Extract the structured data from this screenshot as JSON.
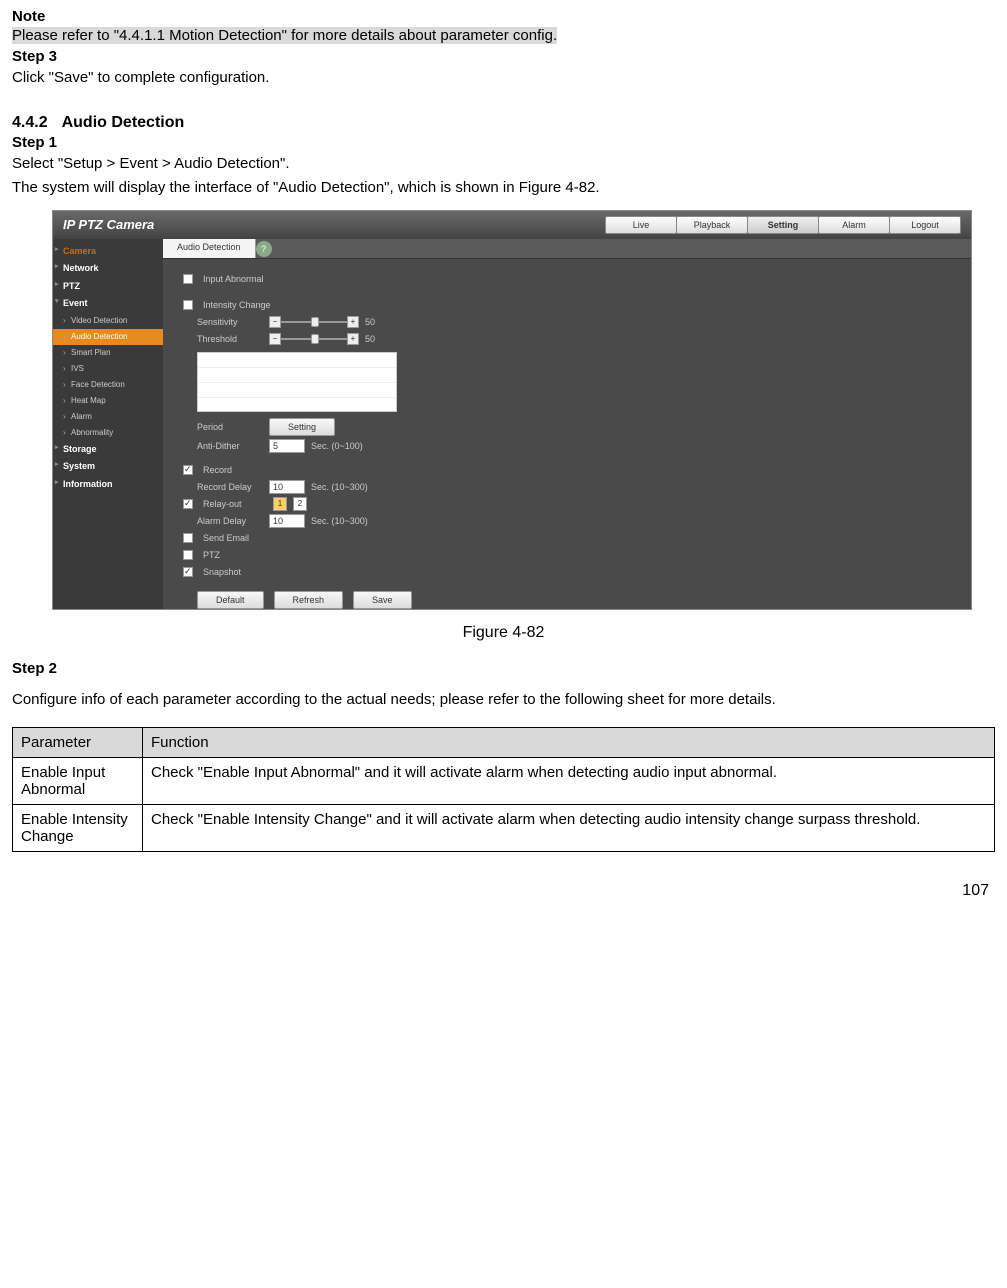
{
  "note": {
    "title": "Note",
    "body": "Please refer to \"4.4.1.1 Motion Detection\" for more details about parameter config."
  },
  "step3": {
    "title": "Step 3",
    "body": "Click \"Save\" to complete configuration."
  },
  "section": {
    "number": "4.4.2",
    "title": "Audio Detection"
  },
  "step1": {
    "title": "Step 1",
    "line1": "Select \"Setup > Event > Audio Detection\".",
    "line2": "The system will display the interface of \"Audio Detection\", which is shown in Figure 4-82."
  },
  "screenshot": {
    "logo": "IP PTZ Camera",
    "nav": {
      "live": "Live",
      "playback": "Playback",
      "setting": "Setting",
      "alarm": "Alarm",
      "logout": "Logout"
    },
    "sidebar": {
      "camera": "Camera",
      "network": "Network",
      "ptz": "PTZ",
      "event": "Event",
      "video_detection": "Video Detection",
      "audio_detection": "Audio Detection",
      "smart_plan": "Smart Plan",
      "ivs": "IVS",
      "face_detection": "Face Detection",
      "heat_map": "Heat Map",
      "alarm": "Alarm",
      "abnormality": "Abnormality",
      "storage": "Storage",
      "system": "System",
      "information": "Information"
    },
    "tab": "Audio Detection",
    "help": "?",
    "form": {
      "input_abnormal": "Input Abnormal",
      "intensity_change": "Intensity Change",
      "sensitivity": "Sensitivity",
      "sensitivity_val": "50",
      "threshold": "Threshold",
      "threshold_val": "50",
      "period": "Period",
      "period_btn": "Setting",
      "anti_dither": "Anti-Dither",
      "anti_dither_val": "5",
      "anti_dither_unit": "Sec. (0~100)",
      "record": "Record",
      "record_delay": "Record Delay",
      "record_delay_val": "10",
      "record_delay_unit": "Sec. (10~300)",
      "relay_out": "Relay-out",
      "relay1": "1",
      "relay2": "2",
      "alarm_delay": "Alarm Delay",
      "alarm_delay_val": "10",
      "alarm_delay_unit": "Sec. (10~300)",
      "send_email": "Send Email",
      "ptz": "PTZ",
      "snapshot": "Snapshot",
      "default": "Default",
      "refresh": "Refresh",
      "save": "Save",
      "minus": "−",
      "plus": "+"
    }
  },
  "figure_caption": "Figure 4-82",
  "step2": {
    "title": "Step 2",
    "body": "Configure info of each parameter according to the actual needs; please refer to the following sheet for more details."
  },
  "table": {
    "header": {
      "param": "Parameter",
      "func": "Function"
    },
    "rows": [
      {
        "param": "Enable Input Abnormal",
        "func": "Check \"Enable Input Abnormal\" and it will activate alarm when detecting audio input abnormal."
      },
      {
        "param": "Enable Intensity Change",
        "func": "Check \"Enable Intensity Change\" and it will activate alarm when detecting audio intensity change surpass threshold."
      }
    ]
  },
  "page_number": "107"
}
